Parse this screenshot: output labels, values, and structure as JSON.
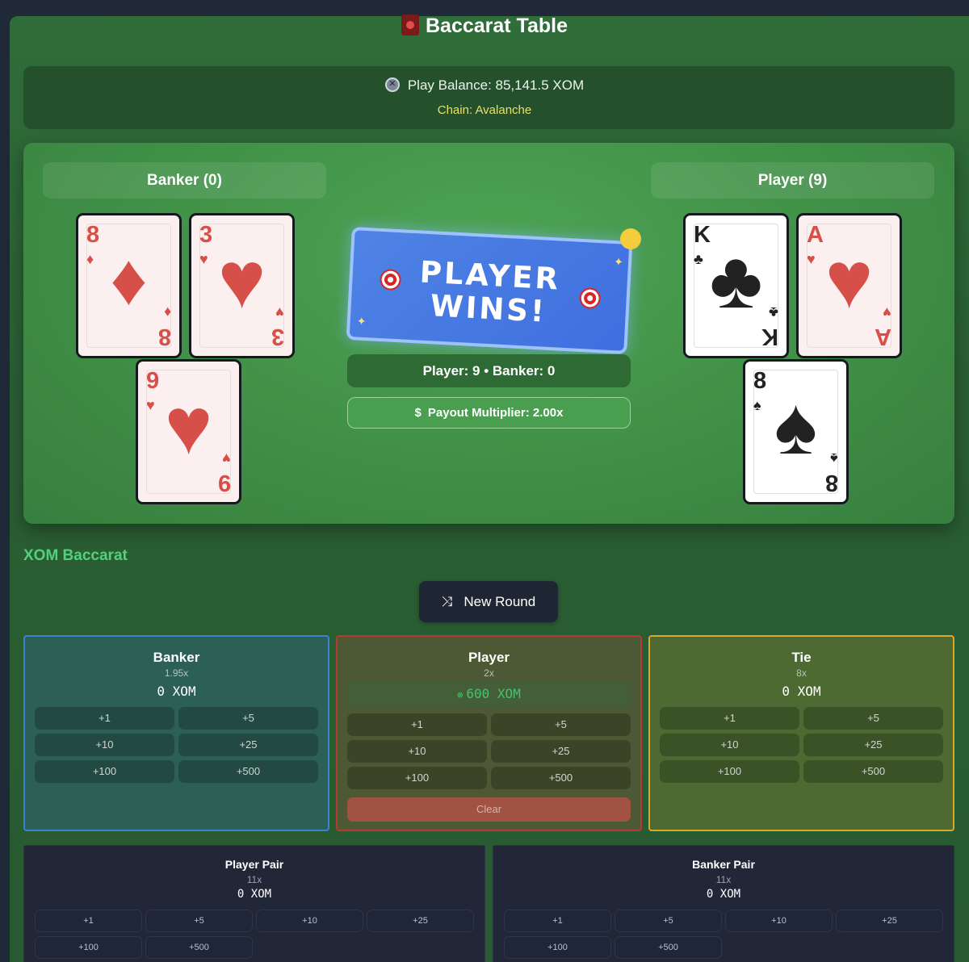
{
  "header": {
    "title": "Baccarat Table",
    "title_icon": "slot-machine-icon"
  },
  "balance": {
    "label": "Play Balance: 85,141.5 XOM",
    "chain": "Chain: Avalanche"
  },
  "banker_hand": {
    "label": "Banker (0)",
    "cards": [
      {
        "rank": "8",
        "suit": "♦"
      },
      {
        "rank": "3",
        "suit": "♥"
      },
      {
        "rank": "9",
        "suit": "♥"
      }
    ]
  },
  "player_hand": {
    "label": "Player (9)",
    "cards": [
      {
        "rank": "K",
        "suit": "♣"
      },
      {
        "rank": "A",
        "suit": "♥"
      },
      {
        "rank": "8",
        "suit": "♠"
      }
    ]
  },
  "result": {
    "line1": "PLAYER",
    "line2": "WINS!",
    "score": "Player: 9 • Banker: 0",
    "payout": "Payout Multiplier: 2.00x",
    "payout_icon": "$"
  },
  "section_title": "XOM Baccarat",
  "new_round_label": "New Round",
  "bets": {
    "banker": {
      "name": "Banker",
      "mult": "1.95x",
      "amount": "0 XOM"
    },
    "player": {
      "name": "Player",
      "mult": "2x",
      "amount": "600 XOM",
      "clear": "Clear"
    },
    "tie": {
      "name": "Tie",
      "mult": "8x",
      "amount": "0 XOM"
    }
  },
  "chips": [
    "+1",
    "+5",
    "+10",
    "+25",
    "+100",
    "+500"
  ],
  "pairs": {
    "player_pair": {
      "name": "Player Pair",
      "mult": "11x",
      "amount": "0 XOM"
    },
    "banker_pair": {
      "name": "Banker Pair",
      "mult": "11x",
      "amount": "0 XOM"
    }
  },
  "colors": {
    "table": "#3f8e46",
    "banner": "#3f6fe0",
    "banker_border": "#3b82d6",
    "player_border": "#b8392f",
    "tie_border": "#d8a929",
    "accent_text": "#52d17c",
    "chain_text": "#e9e06a"
  }
}
